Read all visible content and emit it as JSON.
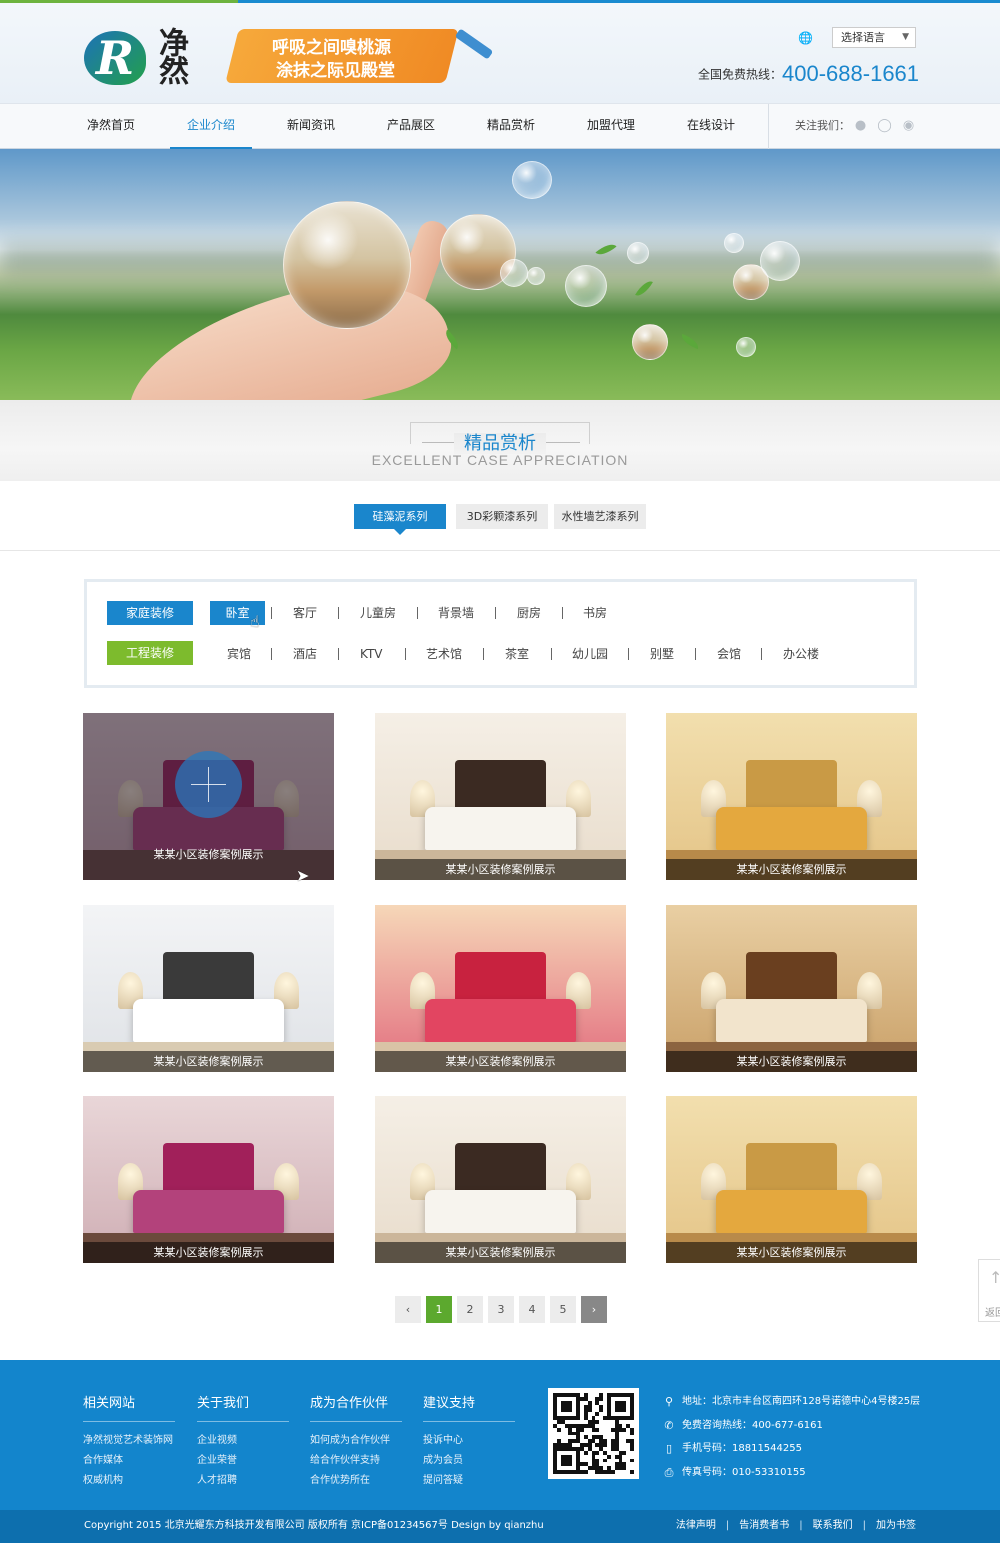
{
  "header": {
    "logo_letter": "R",
    "logo_cn": "净然",
    "slogan": [
      "呼吸之间嗅桃源",
      "涂抹之际见殿堂"
    ],
    "language_select": "选择语言",
    "hotline_label": "全国免费热线：",
    "hotline_number": "400-688-1661"
  },
  "nav": {
    "items": [
      "净然首页",
      "企业介绍",
      "新闻资讯",
      "产品展区",
      "精品赏析",
      "加盟代理",
      "在线设计"
    ],
    "active_index": 1,
    "follow_label": "关注我们：",
    "social_icons": [
      "weibo-icon",
      "tencent-weibo-icon",
      "wechat-icon"
    ]
  },
  "section": {
    "title_cn": "精品赏析",
    "title_en": "EXCELLENT CASE APPRECIATION"
  },
  "tabs": [
    "硅藻泥系列",
    "3D彩颗漆系列",
    "水性墙艺漆系列"
  ],
  "filters": {
    "home": {
      "label": "家庭装修",
      "items": [
        "卧室",
        "客厅",
        "儿童房",
        "背景墙",
        "厨房",
        "书房"
      ],
      "active_item": "卧室"
    },
    "project": {
      "label": "工程装修",
      "items": [
        "宾馆",
        "酒店",
        "KTV",
        "艺术馆",
        "茶室",
        "幼儿园",
        "别墅",
        "会馆",
        "办公楼"
      ]
    }
  },
  "cases": [
    {
      "caption": "某某小区装修案例展示",
      "scene": "pink",
      "hover": true
    },
    {
      "caption": "某某小区装修案例展示",
      "scene": "dark-bed"
    },
    {
      "caption": "某某小区装修案例展示",
      "scene": "gold"
    },
    {
      "caption": "某某小区装修案例展示",
      "scene": "white"
    },
    {
      "caption": "某某小区装修案例展示",
      "scene": "red"
    },
    {
      "caption": "某某小区装修案例展示",
      "scene": "warm"
    },
    {
      "caption": "某某小区装修案例展示",
      "scene": "pink"
    },
    {
      "caption": "某某小区装修案例展示",
      "scene": "dark-bed"
    },
    {
      "caption": "某某小区装修案例展示",
      "scene": "gold"
    }
  ],
  "pagination": {
    "prev": "‹",
    "pages": [
      "1",
      "2",
      "3",
      "4",
      "5"
    ],
    "active": "1",
    "next": "›"
  },
  "back_to_top": "返回",
  "footer": {
    "columns": [
      {
        "title": "相关网站",
        "links": [
          "净然视觉艺术装饰网",
          "合作媒体",
          "权威机构"
        ]
      },
      {
        "title": "关于我们",
        "links": [
          "企业视频",
          "企业荣誉",
          "人才招聘"
        ]
      },
      {
        "title": "成为合作伙伴",
        "links": [
          "如何成为合作伙伴",
          "给合作伙伴支持",
          "合作优势所在"
        ]
      },
      {
        "title": "建议支持",
        "links": [
          "投诉中心",
          "成为会员",
          "提问答疑"
        ]
      }
    ],
    "contact": [
      {
        "icon": "location-icon",
        "text": "地址：北京市丰台区南四环128号诺德中心4号楼25层"
      },
      {
        "icon": "phone-icon",
        "text": "免费咨询热线：400-677-6161"
      },
      {
        "icon": "mobile-icon",
        "text": "手机号码：18811544255"
      },
      {
        "icon": "fax-icon",
        "text": "传真号码：010-53310155"
      }
    ],
    "copyright": "Copyright 2015 北京光耀东方科技开发有限公司 版权所有  京ICP备01234567号  Design by qianzhu",
    "bottom_links": [
      "法律声明",
      "告消费者书",
      "联系我们",
      "加为书签"
    ]
  },
  "colors": {
    "primary_blue": "#1a86cc",
    "accent_green": "#6db33f",
    "footer_blue": "#1385cc",
    "page_active_green": "#5ca92e"
  }
}
